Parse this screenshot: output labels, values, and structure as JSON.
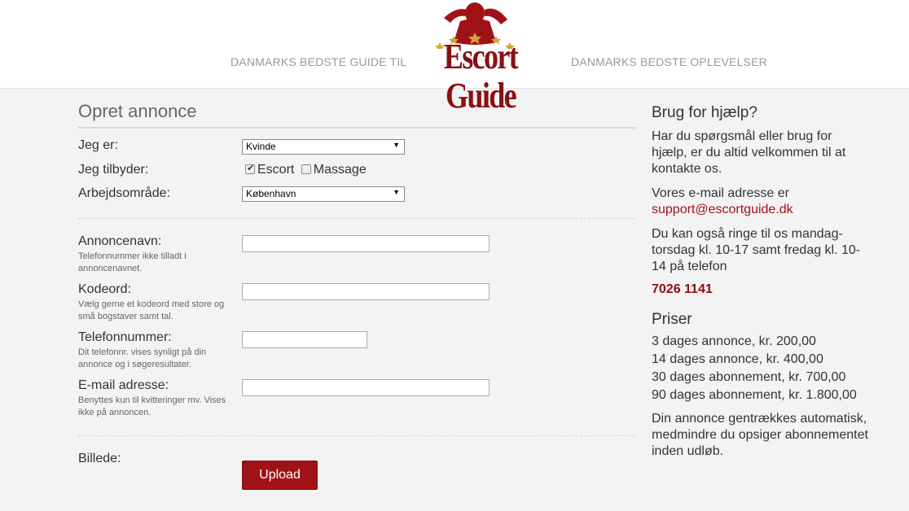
{
  "header": {
    "tagline_left": "DANMARKS BEDSTE GUIDE TIL",
    "tagline_right": "DANMARKS BEDSTE OPLEVELSER",
    "logo_text": "Escort Guide"
  },
  "form": {
    "title": "Opret annonce",
    "jeg_er_label": "Jeg er:",
    "jeg_er_value": "Kvinde",
    "tilbyder_label": "Jeg tilbyder:",
    "tilbyder_options": [
      {
        "label": "Escort",
        "checked": true
      },
      {
        "label": "Massage",
        "checked": false
      }
    ],
    "omraade_label": "Arbejdsområde:",
    "omraade_value": "København",
    "fields": [
      {
        "label": "Annoncenavn:",
        "hint": "Telefonnummer ikke tilladt i annoncenavnet.",
        "value": ""
      },
      {
        "label": "Kodeord:",
        "hint": "Vælg gerne et kodeord med store og små bogstaver samt tal.",
        "value": ""
      },
      {
        "label": "Telefonnummer:",
        "hint": "Dit telefonnr. vises synligt på din annonce og i søgeresultater.",
        "value": ""
      },
      {
        "label": "E-mail adresse:",
        "hint": "Benyttes kun til kvitteringer mv. Vises ikke på annoncen.",
        "value": ""
      }
    ],
    "billede_label": "Billede:",
    "upload_label": "Upload"
  },
  "sidebar": {
    "help_title": "Brug for hjælp?",
    "help_text": "Har du spørgsmål eller brug for hjælp, er du altid velkommen til at kontakte os.",
    "email_intro": "Vores e-mail adresse er",
    "email": "support@escortguide.dk",
    "phone_intro": "Du kan også ringe til os mandag-torsdag kl. 10-17 samt fredag kl. 10-14 på telefon",
    "phone": "7026 1141",
    "prices_title": "Priser",
    "prices": [
      "3 dages annonce, kr. 200,00",
      "14 dages annonce, kr. 400,00",
      "30 dages abonnement, kr. 700,00",
      "90 dages abonnement, kr. 1.800,00"
    ],
    "renew_text": "Din annonce gentrækkes automatisk, medmindre du opsiger abonnementet inden udløb."
  },
  "colors": {
    "brand": "#a11217",
    "brand_dark": "#8b0f12",
    "star": "#d4a43a"
  }
}
